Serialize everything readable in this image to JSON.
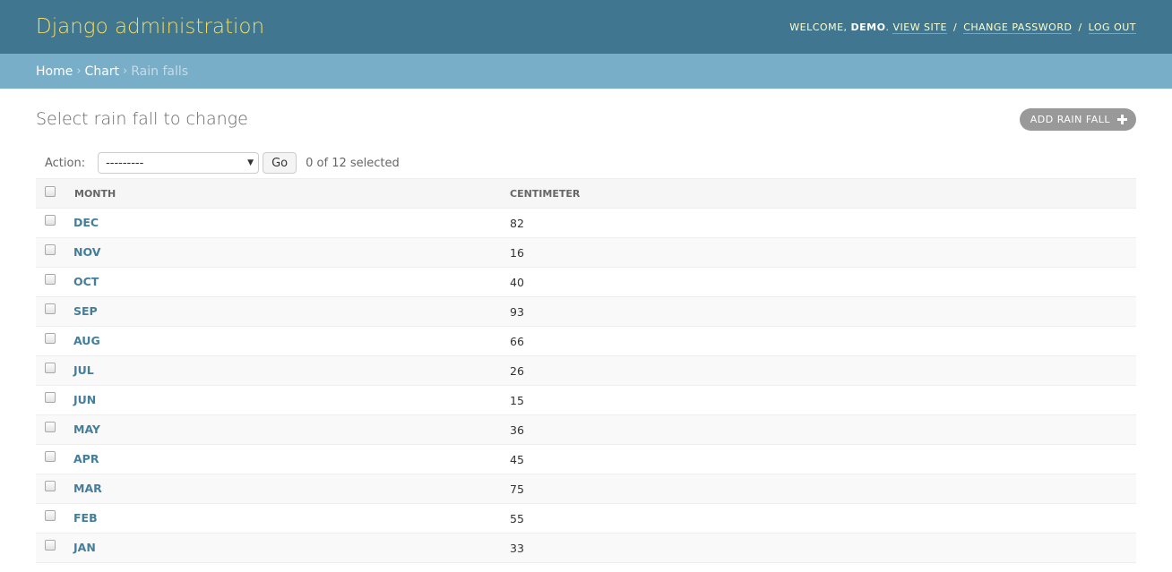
{
  "header": {
    "branding": "Django administration",
    "welcome": "Welcome,",
    "user": "demo",
    "links": {
      "view_site": "View site",
      "change_password": "Change password",
      "log_out": "Log out"
    }
  },
  "breadcrumbs": {
    "home": "Home",
    "app": "Chart",
    "current": "Rain falls"
  },
  "page": {
    "title": "Select rain fall to change",
    "add_button": "Add rain fall"
  },
  "actions": {
    "label": "Action:",
    "selected_option": "---------",
    "go_label": "Go",
    "selection_count": "0 of 12 selected"
  },
  "table": {
    "columns": {
      "month": "Month",
      "centimeter": "Centimeter"
    },
    "rows": [
      {
        "month": "DEC",
        "centimeter": "82"
      },
      {
        "month": "NOV",
        "centimeter": "16"
      },
      {
        "month": "OCT",
        "centimeter": "40"
      },
      {
        "month": "SEP",
        "centimeter": "93"
      },
      {
        "month": "AUG",
        "centimeter": "66"
      },
      {
        "month": "JUL",
        "centimeter": "26"
      },
      {
        "month": "JUN",
        "centimeter": "15"
      },
      {
        "month": "MAY",
        "centimeter": "36"
      },
      {
        "month": "APR",
        "centimeter": "45"
      },
      {
        "month": "MAR",
        "centimeter": "75"
      },
      {
        "month": "FEB",
        "centimeter": "55"
      },
      {
        "month": "JAN",
        "centimeter": "33"
      }
    ]
  },
  "colors": {
    "header_bg": "#417690",
    "branding": "#f5dd5d",
    "breadcrumbs_bg": "#79aec8",
    "link": "#447e9b"
  }
}
